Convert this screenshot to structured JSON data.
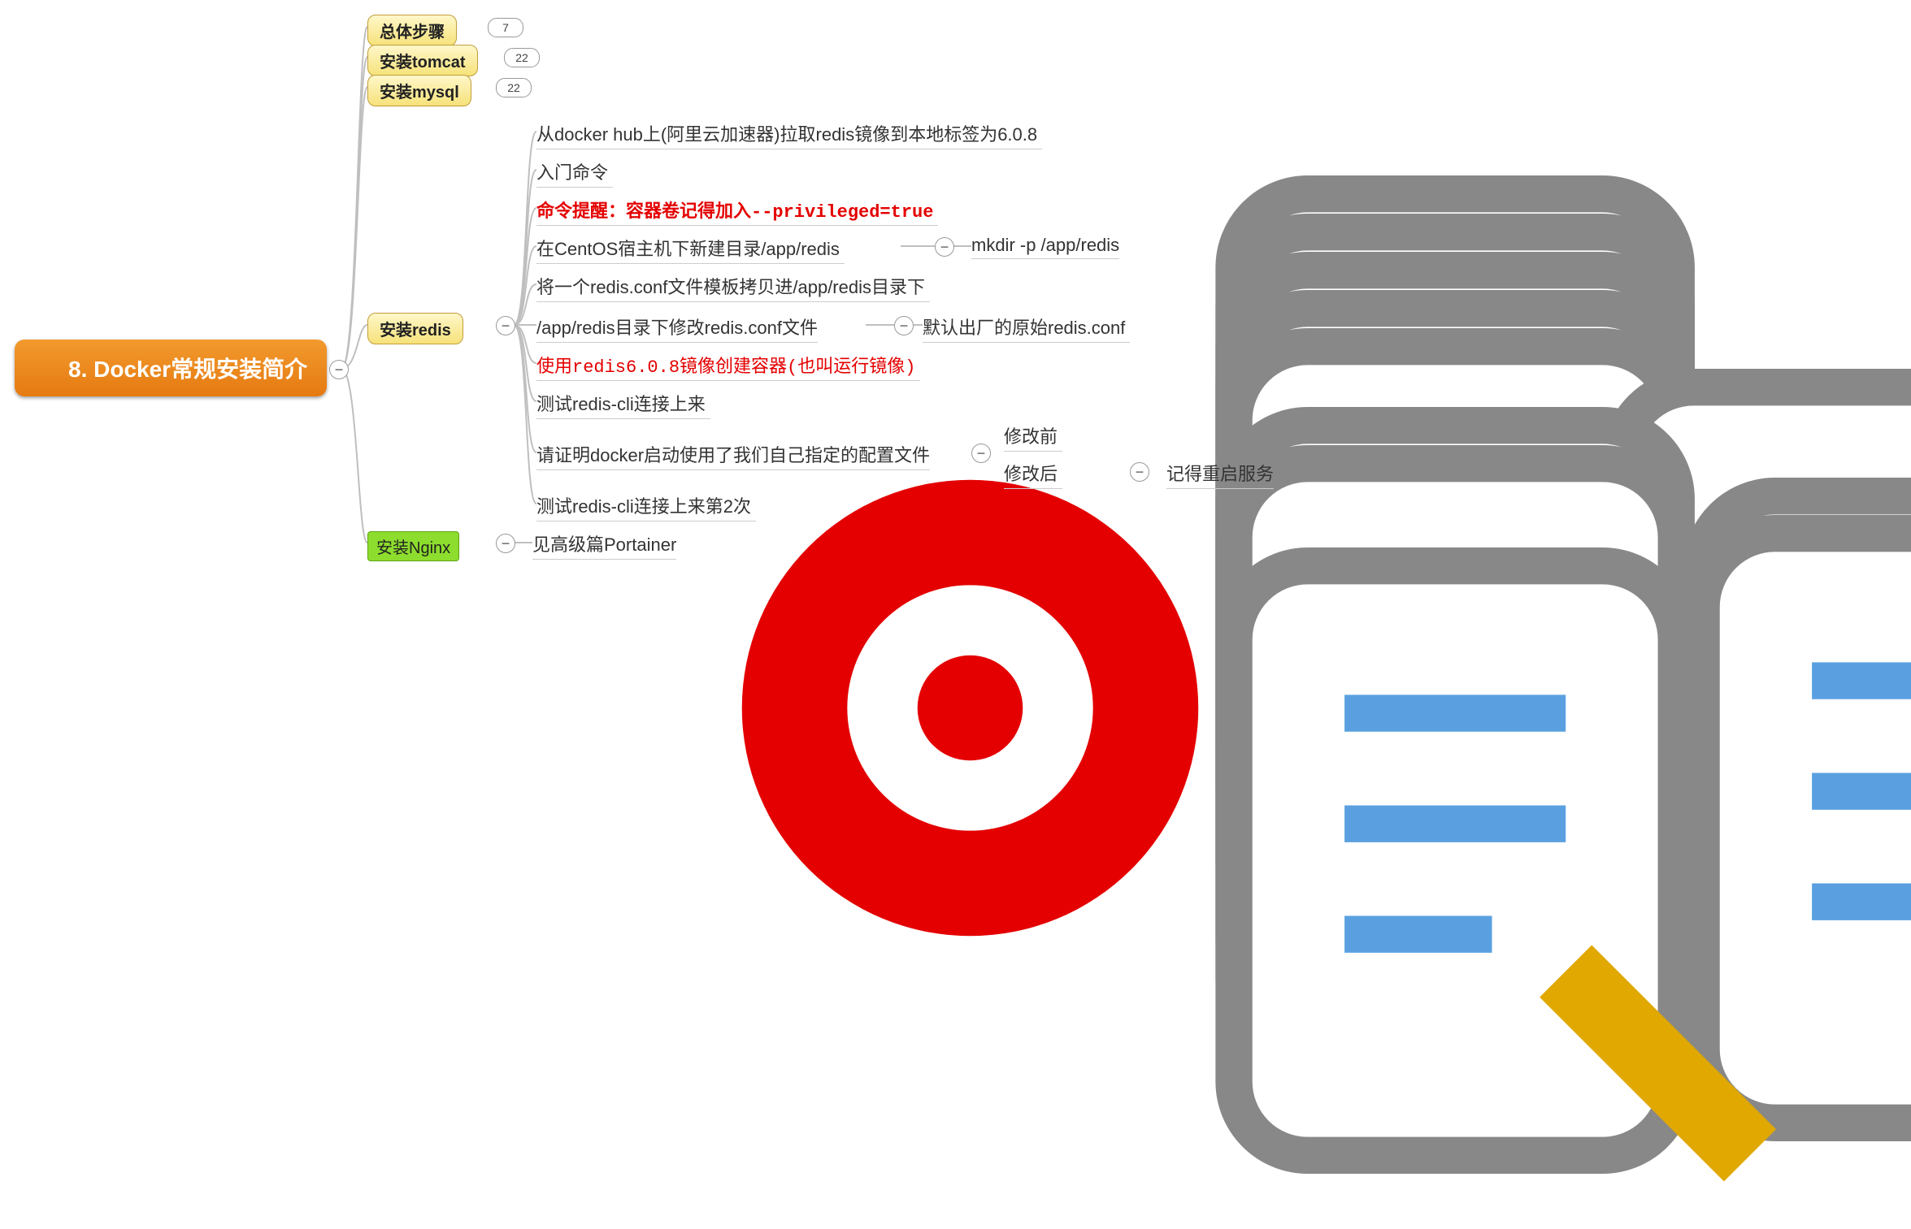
{
  "root": {
    "label": "8. Docker常规安装简介"
  },
  "branches": {
    "overall": {
      "label": "总体步骤",
      "count": "7"
    },
    "tomcat": {
      "label": "安装tomcat",
      "count": "22"
    },
    "mysql": {
      "label": "安装mysql",
      "count": "22"
    },
    "redis": {
      "label": "安装redis"
    },
    "nginx": {
      "label": "安装Nginx"
    }
  },
  "redis": {
    "n1": "从docker hub上(阿里云加速器)拉取redis镜像到本地标签为6.0.8",
    "n2": "入门命令",
    "n3": "命令提醒：容器卷记得加入--privileged=true",
    "n4": "在CentOS宿主机下新建目录/app/redis",
    "n4_cmd": "mkdir -p /app/redis",
    "n5": "将一个redis.conf文件模板拷贝进/app/redis目录下",
    "n6": "/app/redis目录下修改redis.conf文件",
    "n6_sub": "默认出厂的原始redis.conf",
    "n7": "使用redis6.0.8镜像创建容器(也叫运行镜像)",
    "n8": "测试redis-cli连接上来",
    "n9": "请证明docker启动使用了我们自己指定的配置文件",
    "n9_a": "修改前",
    "n9_b": "修改后",
    "n9_b_sub": "记得重启服务",
    "n10": "测试redis-cli连接上来第2次"
  },
  "nginx": {
    "leaf": "见高级篇Portainer"
  },
  "glyphs": {
    "minus": "−"
  }
}
